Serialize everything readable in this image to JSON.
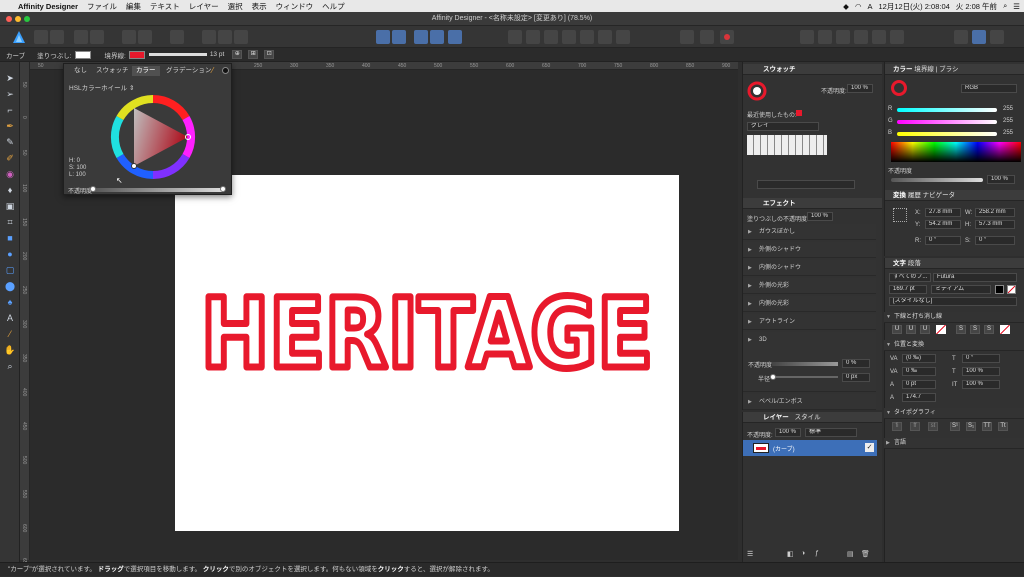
{
  "menubar": {
    "app_name": "Affinity Designer",
    "items": [
      "ファイル",
      "編集",
      "テキスト",
      "レイヤー",
      "選択",
      "表示",
      "ウィンドウ",
      "ヘルプ"
    ],
    "clock_date": "12月12日(火) 2:08:04",
    "clock_time": "火 2:08 午前"
  },
  "window": {
    "title": "Affinity Designer - <名称未設定> [変更あり] (78.5%)"
  },
  "context": {
    "tool_name": "カーブ",
    "fill_label": "塗りつぶし:",
    "stroke_label": "境界線:",
    "stroke_width": "13 pt",
    "fill_color": "#ffffff",
    "stroke_color": "#e8192c"
  },
  "color_popup": {
    "tabs": [
      "なし",
      "スウォッチ",
      "カラー",
      "グラデーション"
    ],
    "mode": "HSLカラーホイール",
    "h": "H: 0",
    "s": "S: 100",
    "l": "L: 100",
    "opacity_label": "不透明度"
  },
  "ruler": {
    "top_labels": [
      "50",
      "0",
      "50",
      "100",
      "150",
      "200",
      "250",
      "300",
      "350",
      "400",
      "450",
      "500",
      "550",
      "600",
      "650",
      "700",
      "750",
      "800",
      "850",
      "900"
    ],
    "left_labels": [
      "50",
      "0",
      "50",
      "100",
      "150",
      "200",
      "250",
      "300",
      "350",
      "400",
      "450",
      "500",
      "550",
      "600",
      "650"
    ]
  },
  "canvas": {
    "artwork_text": "HERITAGE",
    "outline_color": "#e8192c"
  },
  "swatches": {
    "title": "スウォッチ",
    "opacity_label": "不透明度:",
    "opacity_value": "100 %",
    "recent_label": "最近使用したもの:",
    "palette": "グレイ"
  },
  "effects": {
    "title": "エフェクト",
    "fill_opacity_label": "塗りつぶしの不透明度:",
    "fill_opacity_value": "100 %",
    "items": [
      "ガウスぼかし",
      "外側のシャドウ",
      "内側のシャドウ",
      "外側の光彩",
      "内側の光彩",
      "アウトライン",
      "3D",
      "ベベル/エンボス"
    ],
    "opacity_label": "不透明度",
    "opacity_value": "0 %",
    "radius_label": "半径",
    "radius_value": "0 px"
  },
  "layers": {
    "tabs": [
      "レイヤー",
      "スタイル"
    ],
    "opacity_label": "不透明度:",
    "opacity_value": "100 %",
    "blend": "標準",
    "layer_name": "(カーブ)"
  },
  "color_panel": {
    "tabs": [
      "カラー",
      "境界線",
      "ブラシ"
    ],
    "model": "RGB",
    "r": "255",
    "g": "255",
    "b": "255",
    "opacity_label": "不透明度",
    "opacity_value": "100 %"
  },
  "transform": {
    "tabs": [
      "変換",
      "履歴",
      "ナビゲータ"
    ],
    "x_label": "X:",
    "x": "27.8 mm",
    "y_label": "Y:",
    "y": "54.2 mm",
    "w_label": "W:",
    "w": "258.2 mm",
    "h_label": "H:",
    "h": "57.3 mm",
    "r_label": "R:",
    "r": "0 °",
    "s_label": "S:",
    "s": "0 °"
  },
  "text_panel": {
    "tabs": [
      "文字",
      "段落"
    ],
    "font_collection": "すべてのフ...",
    "font": "Futura",
    "size": "169.7 pt",
    "weight": "ミディアム",
    "style": "[スタイルなし]",
    "underline_section": "下線と打ち消し線",
    "position_section": "位置と変換",
    "pos_1": "(0 ‰)",
    "pos_2": "0 ‰",
    "pos_3": "0 pt",
    "pos_4": "174.7",
    "angle": "0 °",
    "scale_h": "100 %",
    "scale_v": "100 %",
    "typography_section": "タイポグラフィ",
    "language_section": "言語",
    "ul_buttons": [
      "U",
      "U",
      "U",
      "S",
      "S",
      "S"
    ],
    "typo_buttons": [
      "fi",
      "ff",
      "st",
      "S¹",
      "S₁",
      "TT",
      "Tt"
    ]
  },
  "statusbar": {
    "text_1": "\"カーブ\"が選択されています。",
    "bold_1": "ドラッグ",
    "text_2": "で選択項目を移動します。",
    "bold_2": "クリック",
    "text_3": "で別のオブジェクトを選択します。何もない領域を",
    "bold_3": "クリック",
    "text_4": "すると、選択が解除されます。"
  }
}
